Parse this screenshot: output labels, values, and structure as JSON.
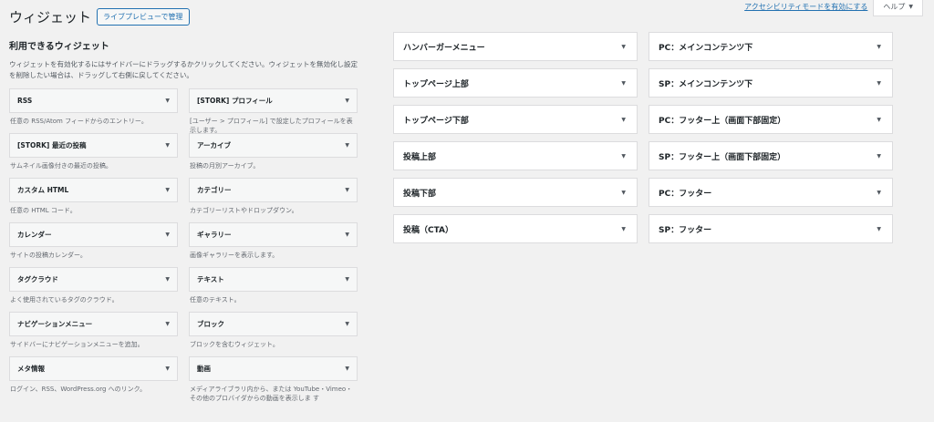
{
  "header": {
    "title": "ウィジェット",
    "preview_button": "ライブプレビューで管理"
  },
  "top": {
    "accessibility_link": "アクセシビリティモードを有効にする",
    "help_label": "ヘルプ"
  },
  "available": {
    "title": "利用できるウィジェット",
    "description": "ウィジェットを有効化するにはサイドバーにドラッグするかクリックしてください。ウィジェットを無効化し設定を削除したい場合は、ドラッグして右側に戻してください。",
    "widgets": [
      {
        "title": "RSS",
        "desc": "任意の RSS/Atom フィードからのエントリー。"
      },
      {
        "title": "[STORK] プロフィール",
        "desc": "[ユーザー > プロフィール] で設定したプロフィールを表示します。"
      },
      {
        "title": "[STORK] 最近の投稿",
        "desc": "サムネイル画像付きの最近の投稿。"
      },
      {
        "title": "アーカイブ",
        "desc": "投稿の月別アーカイブ。"
      },
      {
        "title": "カスタム HTML",
        "desc": "任意の HTML コード。"
      },
      {
        "title": "カテゴリー",
        "desc": "カテゴリーリストやドロップダウン。"
      },
      {
        "title": "カレンダー",
        "desc": "サイトの投稿カレンダー。"
      },
      {
        "title": "ギャラリー",
        "desc": "画像ギャラリーを表示します。"
      },
      {
        "title": "タグクラウド",
        "desc": "よく使用されているタグのクラウド。"
      },
      {
        "title": "テキスト",
        "desc": "任意のテキスト。"
      },
      {
        "title": "ナビゲーションメニュー",
        "desc": "サイドバーにナビゲーションメニューを追加。"
      },
      {
        "title": "ブロック",
        "desc": "ブロックを含むウィジェット。"
      },
      {
        "title": "メタ情報",
        "desc": "ログイン、RSS、WordPress.org へのリンク。"
      },
      {
        "title": "動画",
        "desc": "メディアライブラリ内から、または YouTube・Vimeo・その他のプロバイダからの動画を表示しま す"
      }
    ]
  },
  "sidebars": [
    "ハンバーガーメニュー",
    "PC：メインコンテンツ下",
    "トップページ上部",
    "SP：メインコンテンツ下",
    "トップページ下部",
    "PC：フッター上（画面下部固定）",
    "投稿上部",
    "SP：フッター上（画面下部固定）",
    "投稿下部",
    "PC：フッター",
    "投稿（CTA）",
    "SP：フッター"
  ],
  "icons": {
    "arrow": "▼",
    "help_arrow": "▼"
  },
  "colors": {
    "link": "#2271b1",
    "background": "#f1f1f1"
  }
}
